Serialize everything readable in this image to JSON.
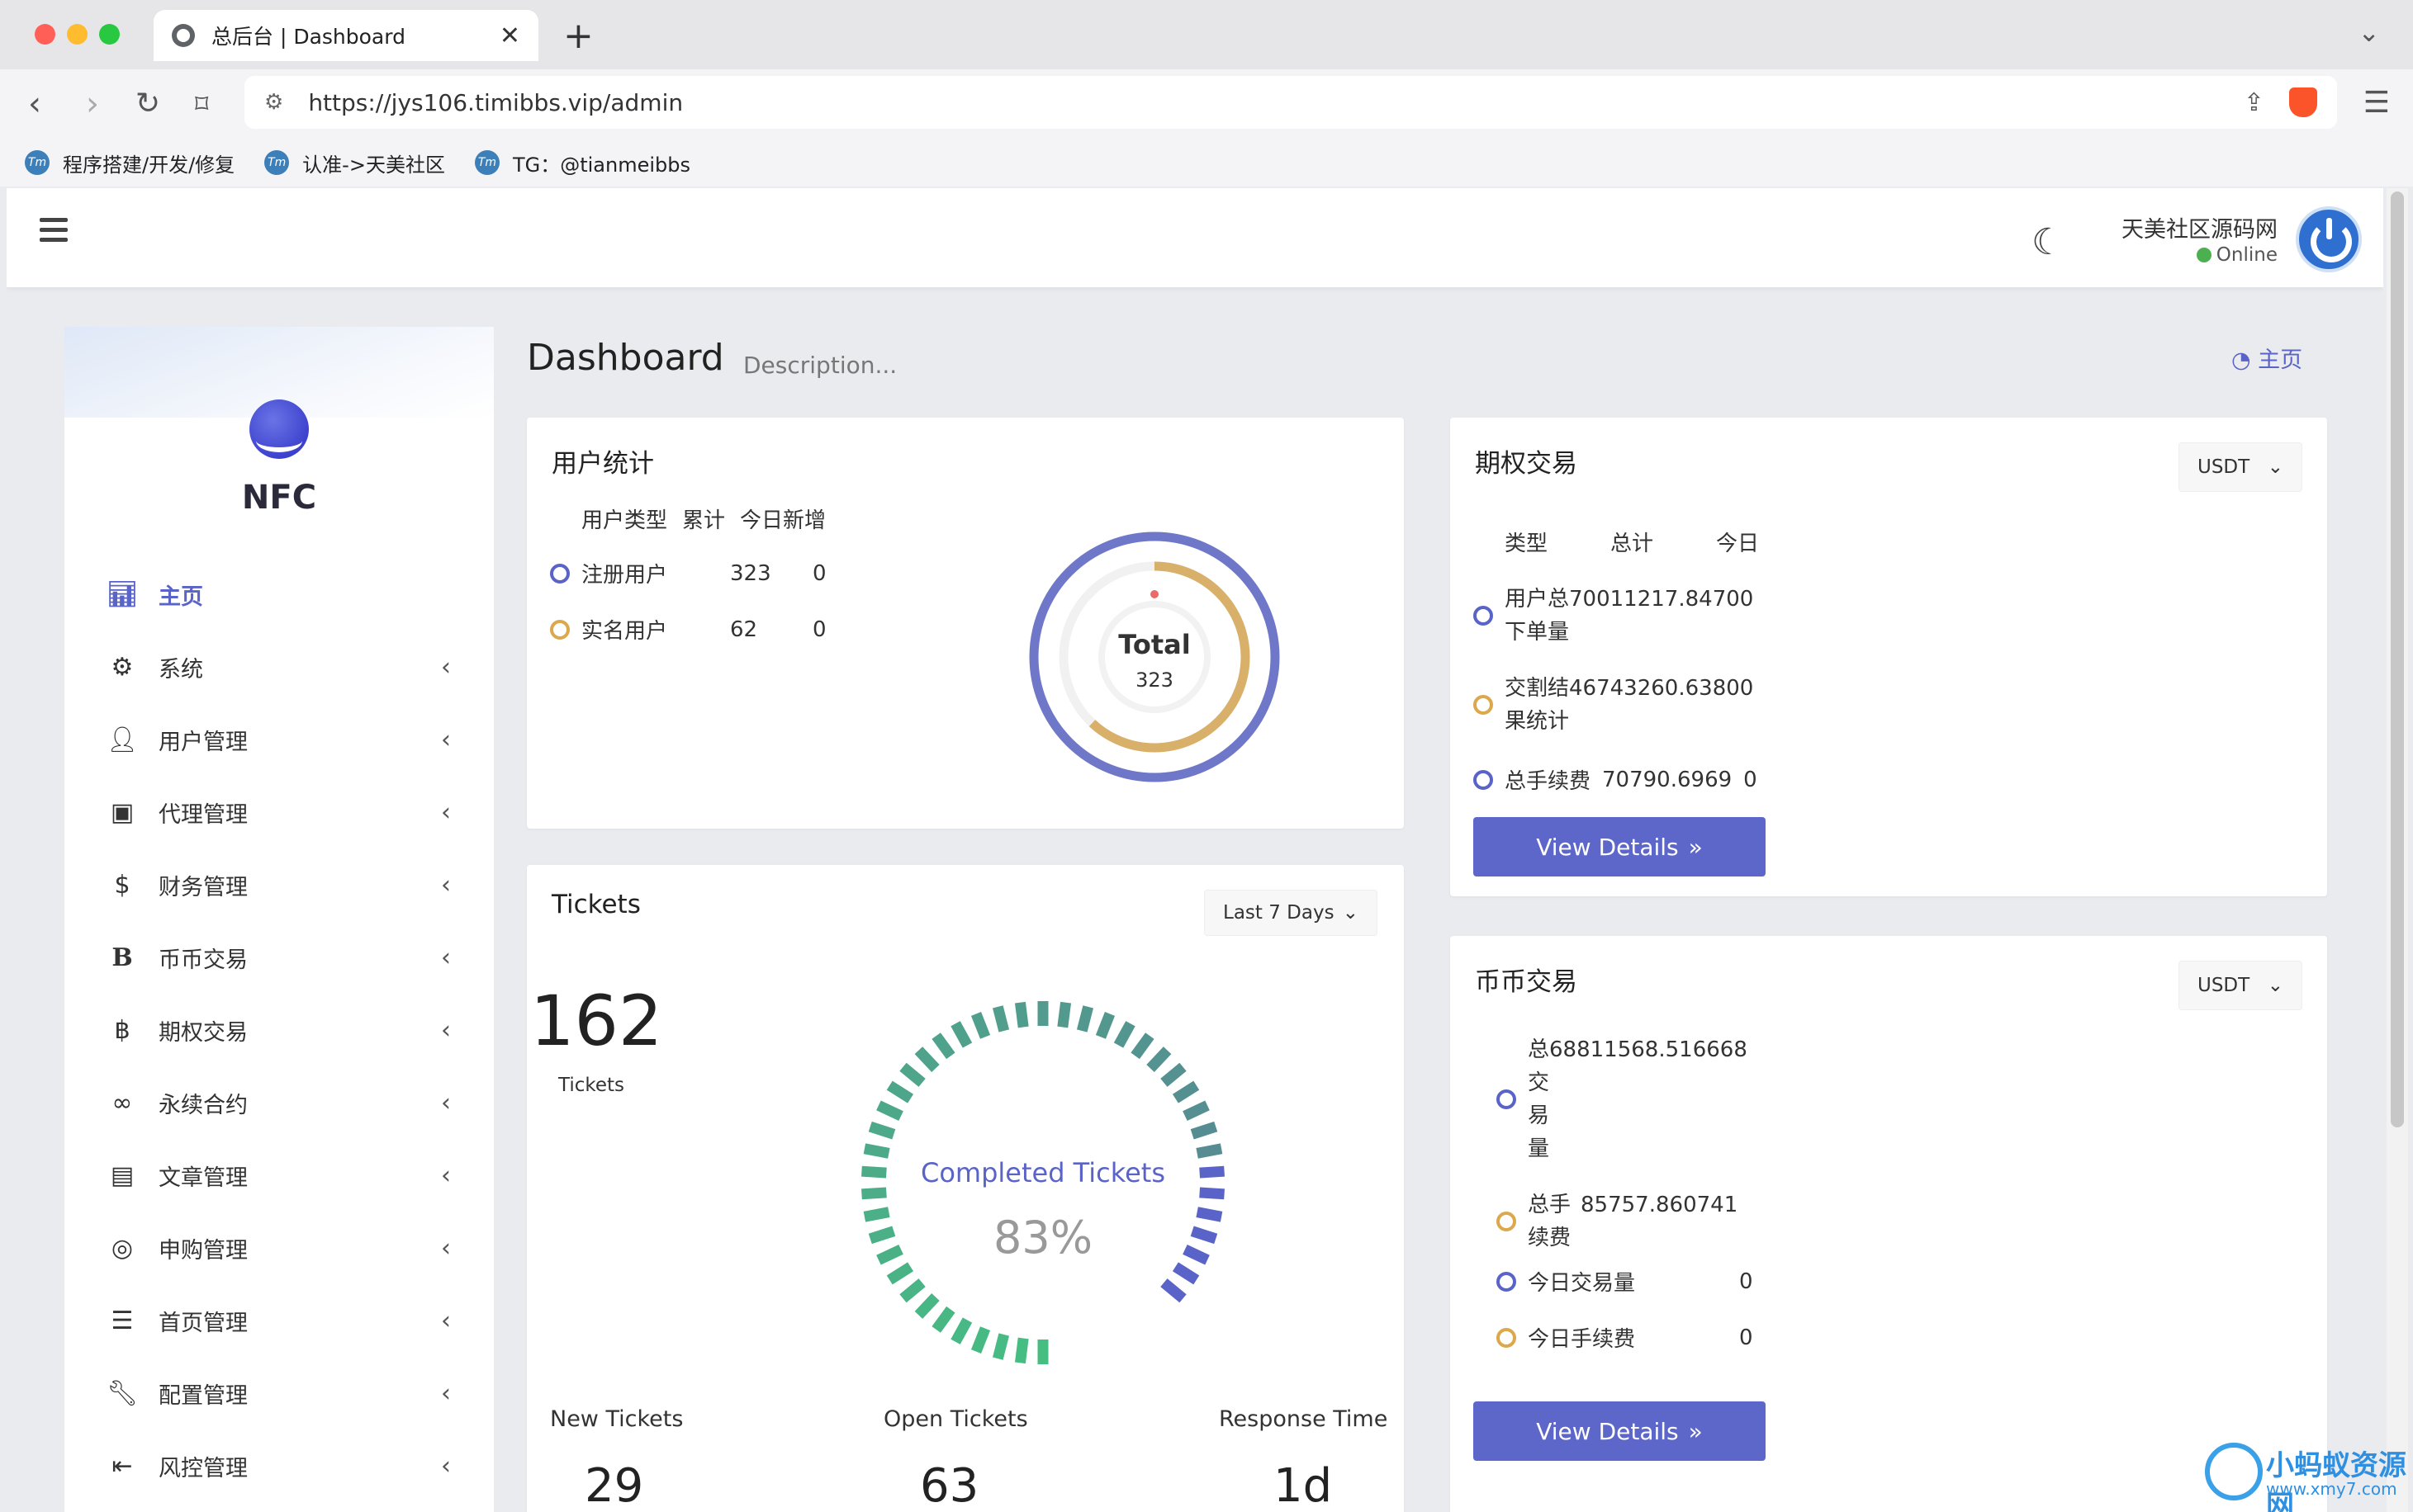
{
  "browser": {
    "tab_title": "总后台 | Dashboard",
    "tab_close": "✕",
    "new_tab": "+",
    "url": "https://jys106.timibbs.vip/admin",
    "bookmarks": [
      {
        "label": "程序搭建/开发/修复"
      },
      {
        "label": "认准->天美社区"
      },
      {
        "label": "TG：@tianmeibbs"
      }
    ]
  },
  "topbar": {
    "user_name": "天美社区源码网",
    "status": "Online"
  },
  "sidebar": {
    "logo_text": "NFC",
    "items": [
      {
        "label": "主页",
        "icon": "bar-chart-icon",
        "active": true
      },
      {
        "label": "系统",
        "icon": "gear-icon"
      },
      {
        "label": "用户管理",
        "icon": "user-icon"
      },
      {
        "label": "代理管理",
        "icon": "id-card-icon"
      },
      {
        "label": "财务管理",
        "icon": "dollar-icon"
      },
      {
        "label": "币币交易",
        "icon": "b-letter-icon"
      },
      {
        "label": "期权交易",
        "icon": "bitcoin-icon"
      },
      {
        "label": "永续合约",
        "icon": "link-icon"
      },
      {
        "label": "文章管理",
        "icon": "newspaper-icon"
      },
      {
        "label": "申购管理",
        "icon": "lifebuoy-icon"
      },
      {
        "label": "首页管理",
        "icon": "list-icon"
      },
      {
        "label": "配置管理",
        "icon": "wrench-icon"
      },
      {
        "label": "风控管理",
        "icon": "indent-icon"
      }
    ]
  },
  "content": {
    "title": "Dashboard",
    "description": "Description...",
    "breadcrumb": "主页"
  },
  "user_stats": {
    "title": "用户统计",
    "headers": [
      "用户类型",
      "累计",
      "今日新增"
    ],
    "rows": [
      {
        "type": "注册用户",
        "total": "323",
        "today": "0"
      },
      {
        "type": "实名用户",
        "total": "62",
        "today": "0"
      }
    ],
    "donut_label": "Total",
    "donut_value": "323",
    "colors": {
      "blue": "#6f77c9",
      "gold": "#d8b06a"
    }
  },
  "options_trading": {
    "title": "期权交易",
    "currency": "USDT",
    "headers": [
      "类型",
      "总计",
      "今日"
    ],
    "rows": [
      {
        "type_line1": "用户总",
        "value": "70011217.84700",
        "type_line2": "下单量"
      },
      {
        "type_line1": "交割结",
        "value": "46743260.63800",
        "type_line2": "果统计"
      },
      {
        "type_line1": "总手续费",
        "value": "70790.6969",
        "today": "0"
      }
    ],
    "button": "View Details"
  },
  "tickets": {
    "title": "Tickets",
    "range": "Last 7 Days",
    "count": "162",
    "count_label": "Tickets",
    "gauge_label": "Completed Tickets",
    "gauge_value": "83%",
    "gauge_percent": 83,
    "stats": [
      {
        "label": "New Tickets",
        "value": "29"
      },
      {
        "label": "Open Tickets",
        "value": "63"
      },
      {
        "label": "Response Time",
        "value": "1d"
      }
    ]
  },
  "spot_trading": {
    "title": "币币交易",
    "currency": "USDT",
    "rows": [
      {
        "label_lines": [
          "总",
          "交",
          "易",
          "量"
        ],
        "value": "68811568.516668"
      },
      {
        "label_lines": [
          "总手",
          "续费"
        ],
        "value": "85757.860741"
      },
      {
        "label": "今日交易量",
        "value": "0"
      },
      {
        "label": "今日手续费",
        "value": "0"
      }
    ],
    "button": "View Details"
  },
  "watermark": {
    "name": "小蚂蚁资源网",
    "url": "www.xmy7.com"
  }
}
